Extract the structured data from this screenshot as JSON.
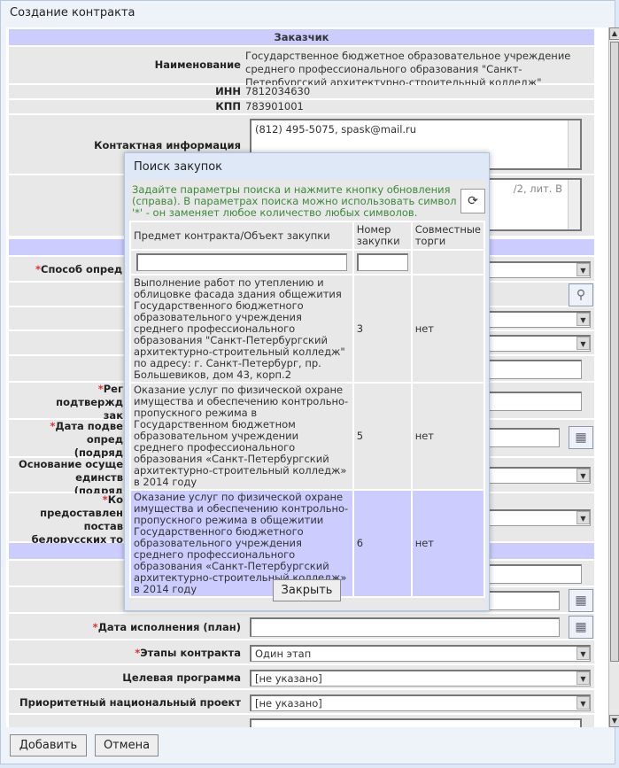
{
  "window": {
    "title": "Создание контракта"
  },
  "customer": {
    "section": "Заказчик",
    "name_label": "Наименование",
    "name": "Государственное бюджетное образовательное учреждение среднего профессионального образования \"Санкт-Петербургский архитектурно-строительный колледж\"",
    "inn_label": "ИНН",
    "inn": "7812034630",
    "kpp_label": "КПП",
    "kpp": "783901001",
    "contact_label": "Контактная информация",
    "contact": "(812) 495-5075, spask@mail.ru",
    "address_partial": "/2, лит. В"
  },
  "form": {
    "method_label": "Способ опред",
    "reg_label_1": "Рег",
    "reg_label_2": "подтвержд",
    "reg_label_3": "зак",
    "date_confirm_1": "Дата подве",
    "date_confirm_2": "опред",
    "date_confirm_3": "(подряд",
    "basis_1": "Основание осуще",
    "basis_2": "единств",
    "basis_3": "(подряд",
    "k_1": "Ко",
    "k_2": "предоставлен",
    "k_3": "постав",
    "k_4": "белорусских то",
    "exec_date_label": "Дата исполнения (план)",
    "stages_label": "Этапы контракта",
    "stages_value": "Один этап",
    "target_label": "Целевая программа",
    "target_value": "[не указано]",
    "priority_label": "Приоритетный национальный проект",
    "priority_value": "[не указано]"
  },
  "buttons": {
    "add": "Добавить",
    "cancel": "Отмена"
  },
  "popup": {
    "title": "Поиск закупок",
    "hint": "Задайте параметры поиска и нажмите кнопку обновления (справа). В параметрах поиска можно использовать символ '*' - он заменяет любое количество любых символов.",
    "columns": [
      "Предмет контракта/Объект закупки",
      "Номер закупки",
      "Совместные торги"
    ],
    "rows": [
      {
        "subject": "Выполнение работ по утеплению и облицовке фасада здания общежития Государственного бюджетного образовательного учреждения среднего профессионального образования \"Санкт-Петербургский архитектурно-строительный колледж\" по адресу: г. Санкт-Петербург, пр. Большевиков, дом 43, корп.2",
        "number": "3",
        "joint": "нет"
      },
      {
        "subject": "Оказание услуг по физической охране имущества и обеспечению  контрольно-пропускного режима в Государственном бюджетном образовательном учреждении среднего профессионального образования «Санкт-Петербургский архитектурно-строительный колледж» в 2014 году",
        "number": "5",
        "joint": "нет"
      },
      {
        "subject": "Оказание услуг по физической охране имущества и обеспечению контрольно-пропускного режима в общежитии Государственного бюджетного образовательного учреждения среднего профессионального образования «Санкт-Петербургский архитектурно-строительный колледж» в 2014 году",
        "number": "6",
        "joint": "нет"
      }
    ],
    "close": "Закрыть"
  }
}
